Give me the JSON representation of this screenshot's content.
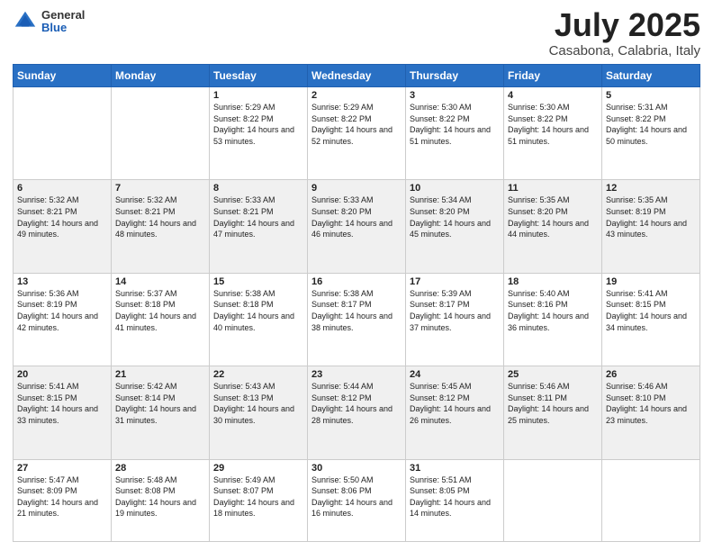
{
  "header": {
    "logo_general": "General",
    "logo_blue": "Blue",
    "title": "July 2025",
    "location": "Casabona, Calabria, Italy"
  },
  "weekdays": [
    "Sunday",
    "Monday",
    "Tuesday",
    "Wednesday",
    "Thursday",
    "Friday",
    "Saturday"
  ],
  "weeks": [
    [
      {
        "day": "",
        "sunrise": "",
        "sunset": "",
        "daylight": ""
      },
      {
        "day": "",
        "sunrise": "",
        "sunset": "",
        "daylight": ""
      },
      {
        "day": "1",
        "sunrise": "Sunrise: 5:29 AM",
        "sunset": "Sunset: 8:22 PM",
        "daylight": "Daylight: 14 hours and 53 minutes."
      },
      {
        "day": "2",
        "sunrise": "Sunrise: 5:29 AM",
        "sunset": "Sunset: 8:22 PM",
        "daylight": "Daylight: 14 hours and 52 minutes."
      },
      {
        "day": "3",
        "sunrise": "Sunrise: 5:30 AM",
        "sunset": "Sunset: 8:22 PM",
        "daylight": "Daylight: 14 hours and 51 minutes."
      },
      {
        "day": "4",
        "sunrise": "Sunrise: 5:30 AM",
        "sunset": "Sunset: 8:22 PM",
        "daylight": "Daylight: 14 hours and 51 minutes."
      },
      {
        "day": "5",
        "sunrise": "Sunrise: 5:31 AM",
        "sunset": "Sunset: 8:22 PM",
        "daylight": "Daylight: 14 hours and 50 minutes."
      }
    ],
    [
      {
        "day": "6",
        "sunrise": "Sunrise: 5:32 AM",
        "sunset": "Sunset: 8:21 PM",
        "daylight": "Daylight: 14 hours and 49 minutes."
      },
      {
        "day": "7",
        "sunrise": "Sunrise: 5:32 AM",
        "sunset": "Sunset: 8:21 PM",
        "daylight": "Daylight: 14 hours and 48 minutes."
      },
      {
        "day": "8",
        "sunrise": "Sunrise: 5:33 AM",
        "sunset": "Sunset: 8:21 PM",
        "daylight": "Daylight: 14 hours and 47 minutes."
      },
      {
        "day": "9",
        "sunrise": "Sunrise: 5:33 AM",
        "sunset": "Sunset: 8:20 PM",
        "daylight": "Daylight: 14 hours and 46 minutes."
      },
      {
        "day": "10",
        "sunrise": "Sunrise: 5:34 AM",
        "sunset": "Sunset: 8:20 PM",
        "daylight": "Daylight: 14 hours and 45 minutes."
      },
      {
        "day": "11",
        "sunrise": "Sunrise: 5:35 AM",
        "sunset": "Sunset: 8:20 PM",
        "daylight": "Daylight: 14 hours and 44 minutes."
      },
      {
        "day": "12",
        "sunrise": "Sunrise: 5:35 AM",
        "sunset": "Sunset: 8:19 PM",
        "daylight": "Daylight: 14 hours and 43 minutes."
      }
    ],
    [
      {
        "day": "13",
        "sunrise": "Sunrise: 5:36 AM",
        "sunset": "Sunset: 8:19 PM",
        "daylight": "Daylight: 14 hours and 42 minutes."
      },
      {
        "day": "14",
        "sunrise": "Sunrise: 5:37 AM",
        "sunset": "Sunset: 8:18 PM",
        "daylight": "Daylight: 14 hours and 41 minutes."
      },
      {
        "day": "15",
        "sunrise": "Sunrise: 5:38 AM",
        "sunset": "Sunset: 8:18 PM",
        "daylight": "Daylight: 14 hours and 40 minutes."
      },
      {
        "day": "16",
        "sunrise": "Sunrise: 5:38 AM",
        "sunset": "Sunset: 8:17 PM",
        "daylight": "Daylight: 14 hours and 38 minutes."
      },
      {
        "day": "17",
        "sunrise": "Sunrise: 5:39 AM",
        "sunset": "Sunset: 8:17 PM",
        "daylight": "Daylight: 14 hours and 37 minutes."
      },
      {
        "day": "18",
        "sunrise": "Sunrise: 5:40 AM",
        "sunset": "Sunset: 8:16 PM",
        "daylight": "Daylight: 14 hours and 36 minutes."
      },
      {
        "day": "19",
        "sunrise": "Sunrise: 5:41 AM",
        "sunset": "Sunset: 8:15 PM",
        "daylight": "Daylight: 14 hours and 34 minutes."
      }
    ],
    [
      {
        "day": "20",
        "sunrise": "Sunrise: 5:41 AM",
        "sunset": "Sunset: 8:15 PM",
        "daylight": "Daylight: 14 hours and 33 minutes."
      },
      {
        "day": "21",
        "sunrise": "Sunrise: 5:42 AM",
        "sunset": "Sunset: 8:14 PM",
        "daylight": "Daylight: 14 hours and 31 minutes."
      },
      {
        "day": "22",
        "sunrise": "Sunrise: 5:43 AM",
        "sunset": "Sunset: 8:13 PM",
        "daylight": "Daylight: 14 hours and 30 minutes."
      },
      {
        "day": "23",
        "sunrise": "Sunrise: 5:44 AM",
        "sunset": "Sunset: 8:12 PM",
        "daylight": "Daylight: 14 hours and 28 minutes."
      },
      {
        "day": "24",
        "sunrise": "Sunrise: 5:45 AM",
        "sunset": "Sunset: 8:12 PM",
        "daylight": "Daylight: 14 hours and 26 minutes."
      },
      {
        "day": "25",
        "sunrise": "Sunrise: 5:46 AM",
        "sunset": "Sunset: 8:11 PM",
        "daylight": "Daylight: 14 hours and 25 minutes."
      },
      {
        "day": "26",
        "sunrise": "Sunrise: 5:46 AM",
        "sunset": "Sunset: 8:10 PM",
        "daylight": "Daylight: 14 hours and 23 minutes."
      }
    ],
    [
      {
        "day": "27",
        "sunrise": "Sunrise: 5:47 AM",
        "sunset": "Sunset: 8:09 PM",
        "daylight": "Daylight: 14 hours and 21 minutes."
      },
      {
        "day": "28",
        "sunrise": "Sunrise: 5:48 AM",
        "sunset": "Sunset: 8:08 PM",
        "daylight": "Daylight: 14 hours and 19 minutes."
      },
      {
        "day": "29",
        "sunrise": "Sunrise: 5:49 AM",
        "sunset": "Sunset: 8:07 PM",
        "daylight": "Daylight: 14 hours and 18 minutes."
      },
      {
        "day": "30",
        "sunrise": "Sunrise: 5:50 AM",
        "sunset": "Sunset: 8:06 PM",
        "daylight": "Daylight: 14 hours and 16 minutes."
      },
      {
        "day": "31",
        "sunrise": "Sunrise: 5:51 AM",
        "sunset": "Sunset: 8:05 PM",
        "daylight": "Daylight: 14 hours and 14 minutes."
      },
      {
        "day": "",
        "sunrise": "",
        "sunset": "",
        "daylight": ""
      },
      {
        "day": "",
        "sunrise": "",
        "sunset": "",
        "daylight": ""
      }
    ]
  ]
}
